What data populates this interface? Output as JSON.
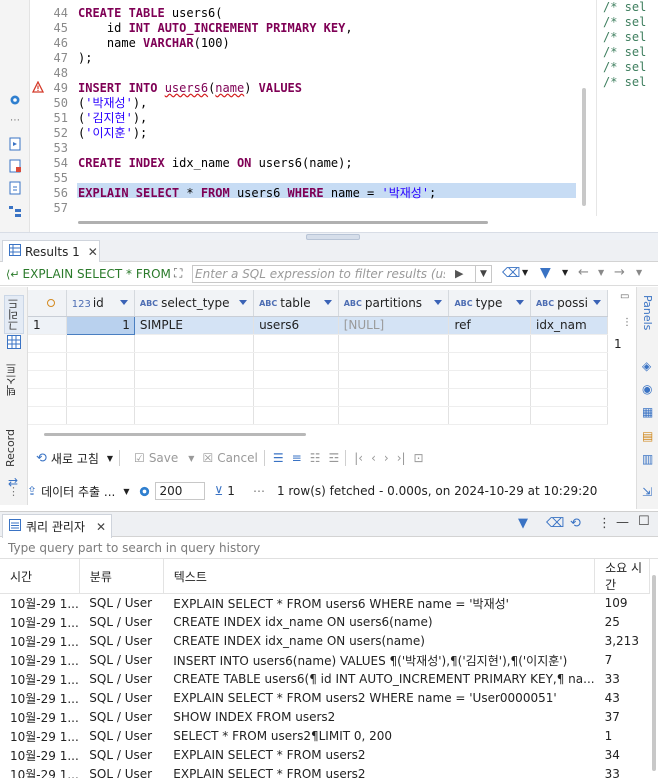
{
  "editor": {
    "lines": [
      {
        "num": "44",
        "tokens": [
          {
            "t": "CREATE TABLE ",
            "c": "kw"
          },
          {
            "t": "users6(",
            "c": ""
          }
        ]
      },
      {
        "num": "45",
        "tokens": [
          {
            "t": "    id ",
            "c": ""
          },
          {
            "t": "INT AUTO_INCREMENT PRIMARY KEY",
            "c": "kw"
          },
          {
            "t": ",",
            "c": ""
          }
        ]
      },
      {
        "num": "46",
        "tokens": [
          {
            "t": "    name ",
            "c": ""
          },
          {
            "t": "VARCHAR",
            "c": "kw"
          },
          {
            "t": "(100)",
            "c": ""
          }
        ]
      },
      {
        "num": "47",
        "tokens": [
          {
            "t": ");",
            "c": ""
          }
        ]
      },
      {
        "num": "48",
        "tokens": []
      },
      {
        "num": "49",
        "tokens": [
          {
            "t": "INSERT INTO ",
            "c": "kw"
          },
          {
            "t": "users6",
            "c": "err"
          },
          {
            "t": "(",
            "c": ""
          },
          {
            "t": "name",
            "c": "err"
          },
          {
            "t": ") ",
            "c": ""
          },
          {
            "t": "VALUES",
            "c": "kw"
          }
        ]
      },
      {
        "num": "50",
        "tokens": [
          {
            "t": "(",
            "c": ""
          },
          {
            "t": "'박재성'",
            "c": "str"
          },
          {
            "t": "),",
            "c": ""
          }
        ]
      },
      {
        "num": "51",
        "tokens": [
          {
            "t": "(",
            "c": ""
          },
          {
            "t": "'김지현'",
            "c": "str"
          },
          {
            "t": "),",
            "c": ""
          }
        ]
      },
      {
        "num": "52",
        "tokens": [
          {
            "t": "(",
            "c": ""
          },
          {
            "t": "'이지훈'",
            "c": "str"
          },
          {
            "t": ");",
            "c": ""
          }
        ]
      },
      {
        "num": "53",
        "tokens": []
      },
      {
        "num": "54",
        "tokens": [
          {
            "t": "CREATE INDEX ",
            "c": "kw"
          },
          {
            "t": "idx_name ",
            "c": ""
          },
          {
            "t": "ON ",
            "c": "kw"
          },
          {
            "t": "users6(name);",
            "c": ""
          }
        ]
      },
      {
        "num": "55",
        "tokens": []
      },
      {
        "num": "56",
        "tokens": [
          {
            "t": "EXPLAIN SELECT ",
            "c": "kw"
          },
          {
            "t": "* ",
            "c": ""
          },
          {
            "t": "FROM ",
            "c": "kw"
          },
          {
            "t": "users6 ",
            "c": ""
          },
          {
            "t": "WHERE ",
            "c": "kw"
          },
          {
            "t": "name = ",
            "c": ""
          },
          {
            "t": "'박재성'",
            "c": "str"
          },
          {
            "t": ";",
            "c": ""
          }
        ]
      },
      {
        "num": "57",
        "tokens": []
      }
    ],
    "minimap": [
      "/* sel",
      "/* sel",
      "/* sel",
      "/* sel",
      "/* sel",
      "/* sel"
    ]
  },
  "results": {
    "tab_label": "Results 1",
    "filter_source": "EXPLAIN SELECT * FROM",
    "filter_placeholder": "Enter a SQL expression to filter results (use Ctrl",
    "vtabs": [
      "그리드",
      "텍스트",
      "Record"
    ],
    "columns": [
      {
        "label": "id",
        "type": "123",
        "width": 73
      },
      {
        "label": "select_type",
        "type": "ABC",
        "width": 123
      },
      {
        "label": "table",
        "type": "ABC",
        "width": 89
      },
      {
        "label": "partitions",
        "type": "ABC",
        "width": 115
      },
      {
        "label": "type",
        "type": "ABC",
        "width": 86
      },
      {
        "label": "possi",
        "type": "ABC",
        "width": 80
      }
    ],
    "rows": [
      {
        "num": "1",
        "cells": [
          "1",
          "SIMPLE",
          "users6",
          "[NULL]",
          "ref",
          "idx_nam"
        ]
      }
    ],
    "right_count": "1",
    "right_panel_label": "Panels",
    "toolbar": {
      "refresh": "새로 고침",
      "save": "Save",
      "cancel": "Cancel",
      "export": "데이터 추출 ...",
      "fetch_size": "200",
      "row_count": "1",
      "status": "1 row(s) fetched - 0.000s, on 2024-10-29 at 10:29:20"
    }
  },
  "query_manager": {
    "tab_label": "쿼리 관리자",
    "search_placeholder": "Type query part to search in query history",
    "columns": [
      {
        "label": "시간",
        "width": 80
      },
      {
        "label": "분류",
        "width": 100
      },
      {
        "label": "텍스트",
        "width": 400
      },
      {
        "label": "소요 시간",
        "width": 70
      }
    ],
    "rows": [
      [
        "10월-29 1...",
        "SQL / User",
        "EXPLAIN SELECT * FROM users6 WHERE name = '박재성'",
        "109"
      ],
      [
        "10월-29 1...",
        "SQL / User",
        "CREATE INDEX idx_name ON users6(name)",
        "25"
      ],
      [
        "10월-29 1...",
        "SQL / User",
        "CREATE INDEX idx_name ON users(name)",
        "3,213"
      ],
      [
        "10월-29 1...",
        "SQL / User",
        "INSERT INTO users6(name) VALUES ¶('박재성'),¶('김지현'),¶('이지훈')",
        "7"
      ],
      [
        "10월-29 1...",
        "SQL / User",
        "CREATE TABLE users6(¶ id INT AUTO_INCREMENT PRIMARY KEY,¶ na...",
        "33"
      ],
      [
        "10월-29 1...",
        "SQL / User",
        "EXPLAIN SELECT * FROM users2 WHERE name = 'User0000051'",
        "43"
      ],
      [
        "10월-29 1...",
        "SQL / User",
        "SHOW INDEX FROM users2",
        "37"
      ],
      [
        "10월-29 1...",
        "SQL / User",
        "SELECT * FROM users2¶LIMIT 0, 200",
        "1"
      ],
      [
        "10월-29 1...",
        "SQL / User",
        "EXPLAIN SELECT * FROM users2",
        "34"
      ],
      [
        "10월-29 1...",
        "SQL / User",
        "EXPLAIN SELECT * FROM users2",
        "33"
      ]
    ]
  },
  "colors": {
    "keyword": "#7f0055",
    "string": "#2a00ff",
    "selection": "#c7dcf4",
    "accent": "#3b63b6"
  }
}
